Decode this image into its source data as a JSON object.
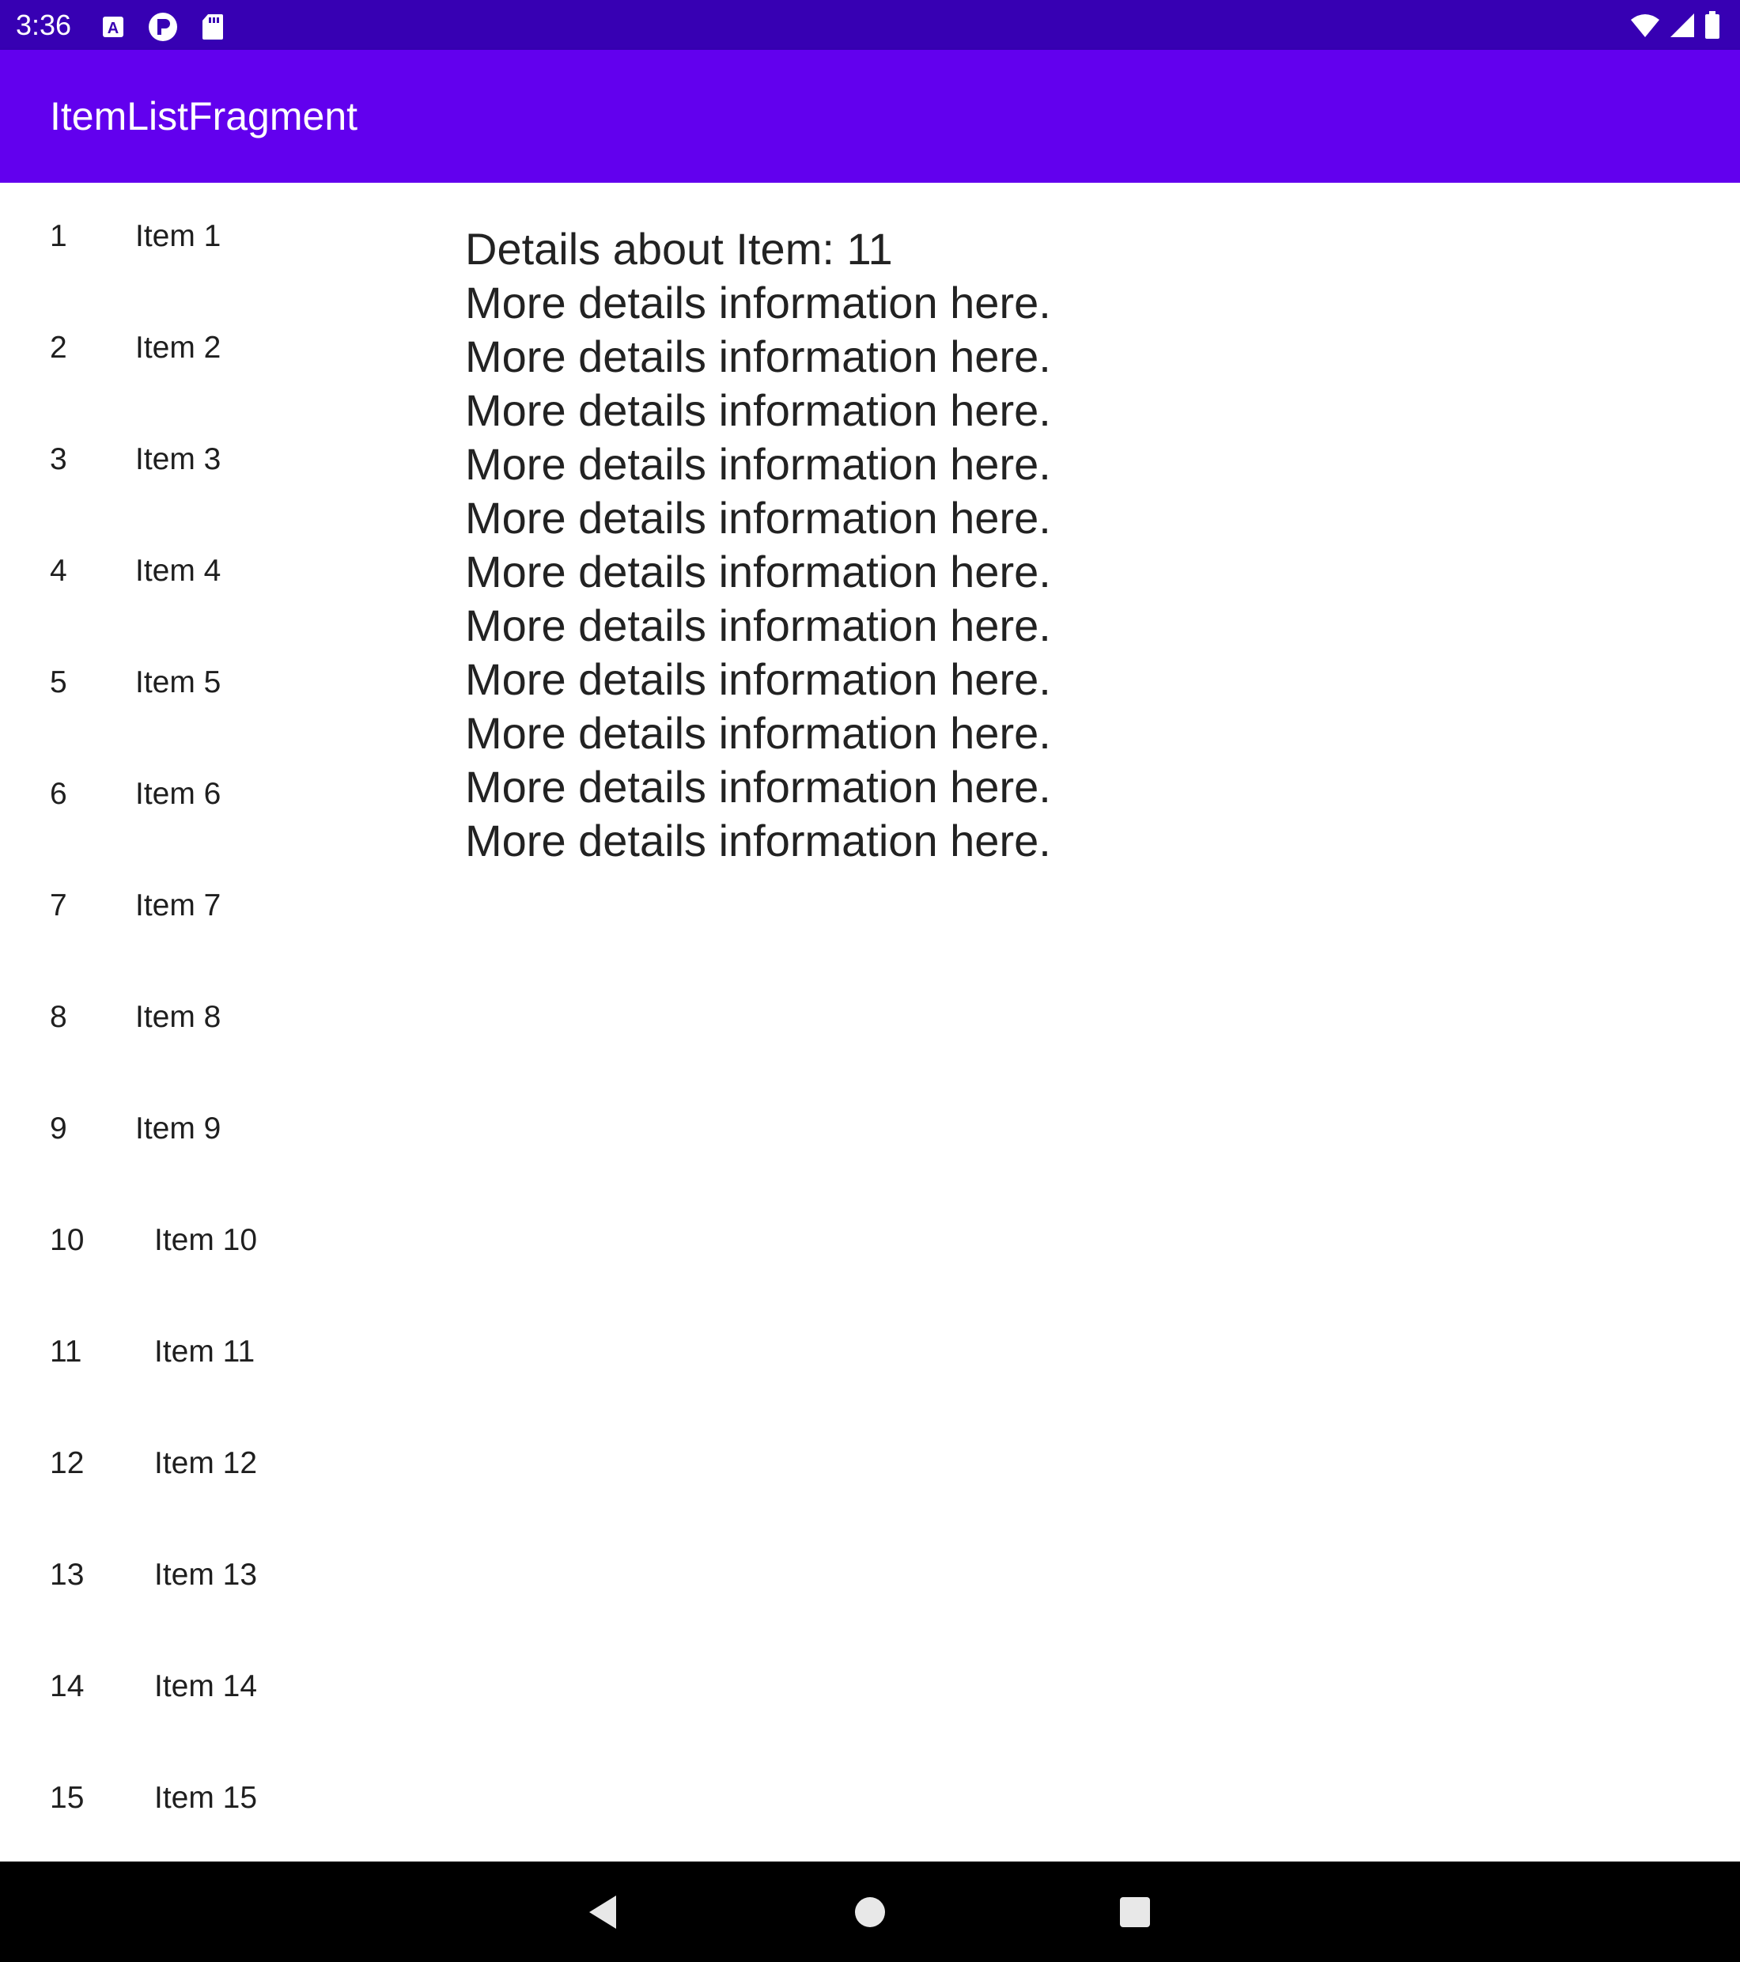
{
  "status_bar": {
    "time": "3:36",
    "left_icons": [
      "app-a-icon",
      "app-p-icon",
      "sd-card-icon"
    ],
    "right_icons": [
      "wifi-icon",
      "cell-signal-icon",
      "battery-icon"
    ]
  },
  "app_bar": {
    "title": "ItemListFragment"
  },
  "items": [
    {
      "number": "1",
      "label": "Item 1"
    },
    {
      "number": "2",
      "label": "Item 2"
    },
    {
      "number": "3",
      "label": "Item 3"
    },
    {
      "number": "4",
      "label": "Item 4"
    },
    {
      "number": "5",
      "label": "Item 5"
    },
    {
      "number": "6",
      "label": "Item 6"
    },
    {
      "number": "7",
      "label": "Item 7"
    },
    {
      "number": "8",
      "label": "Item 8"
    },
    {
      "number": "9",
      "label": "Item 9"
    },
    {
      "number": "10",
      "label": "Item 10"
    },
    {
      "number": "11",
      "label": "Item 11"
    },
    {
      "number": "12",
      "label": "Item 12"
    },
    {
      "number": "13",
      "label": "Item 13"
    },
    {
      "number": "14",
      "label": "Item 14"
    },
    {
      "number": "15",
      "label": "Item 15"
    }
  ],
  "details": {
    "heading": "Details about Item: 11",
    "lines": [
      "More details information here.",
      "More details information here.",
      "More details information here.",
      "More details information here.",
      "More details information here.",
      "More details information here.",
      "More details information here.",
      "More details information here.",
      "More details information here.",
      "More details information here.",
      "More details information here."
    ]
  },
  "nav_bar": {
    "buttons": [
      "back-icon",
      "home-icon",
      "recents-icon"
    ]
  },
  "colors": {
    "status_bar": "#3700b3",
    "app_bar": "#6200ee",
    "nav_bar": "#000000"
  }
}
